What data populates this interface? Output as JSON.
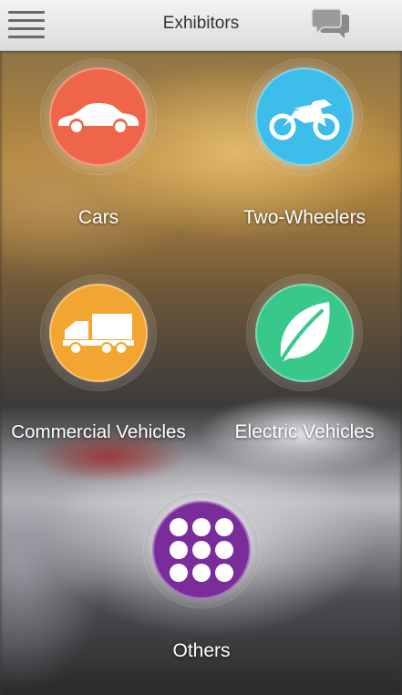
{
  "header": {
    "title": "Exhibitors",
    "menu_icon": "hamburger-menu-icon",
    "chat_icon": "chat-bubbles-icon"
  },
  "categories": [
    {
      "label": "Cars",
      "icon": "car-icon",
      "color": "#ee6549"
    },
    {
      "label": "Two-Wheelers",
      "icon": "motorcycle-icon",
      "color": "#3dbdea"
    },
    {
      "label": "Commercial Vehicles",
      "icon": "truck-icon",
      "color": "#f2a631"
    },
    {
      "label": "Electric Vehicles",
      "icon": "leaf-icon",
      "color": "#37c88a"
    },
    {
      "label": "Others",
      "icon": "grid-dots-icon",
      "color": "#7b2c9b"
    }
  ]
}
